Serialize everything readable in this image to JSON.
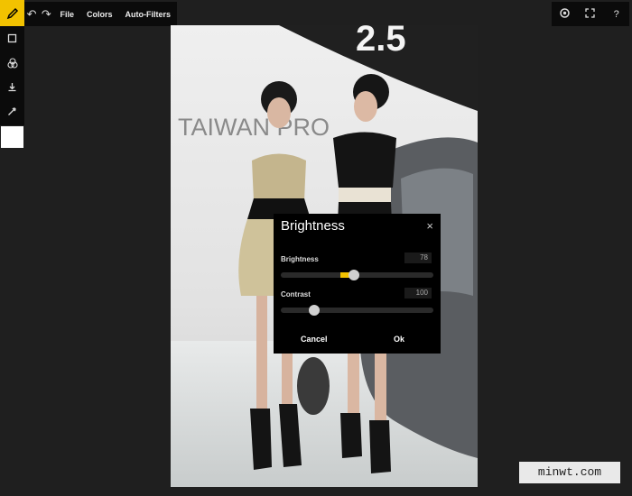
{
  "toolbar": {
    "menu_items": [
      "File",
      "Colors",
      "Auto-Filters"
    ],
    "undo_icon": "undo-icon",
    "redo_icon": "redo-icon",
    "right_icons": [
      "chrome-icon",
      "fullscreen-icon",
      "help-icon"
    ],
    "help_label": "?"
  },
  "left_tools": [
    "crop-icon",
    "filters-icon",
    "download-icon",
    "eyedropper-icon"
  ],
  "swatch_color": "#ffffff",
  "accent_color": "#f2c200",
  "photo": {
    "background_sign": "TAIWAN PRO"
  },
  "dialog": {
    "title": "Brightness",
    "close_label": "×",
    "brightness_label": "Brightness",
    "brightness_value": "78",
    "brightness_level": 0.48,
    "contrast_label": "Contrast",
    "contrast_value": "100",
    "contrast_level": 0.22,
    "cancel_label": "Cancel",
    "ok_label": "Ok"
  },
  "watermark": "minwt.com"
}
